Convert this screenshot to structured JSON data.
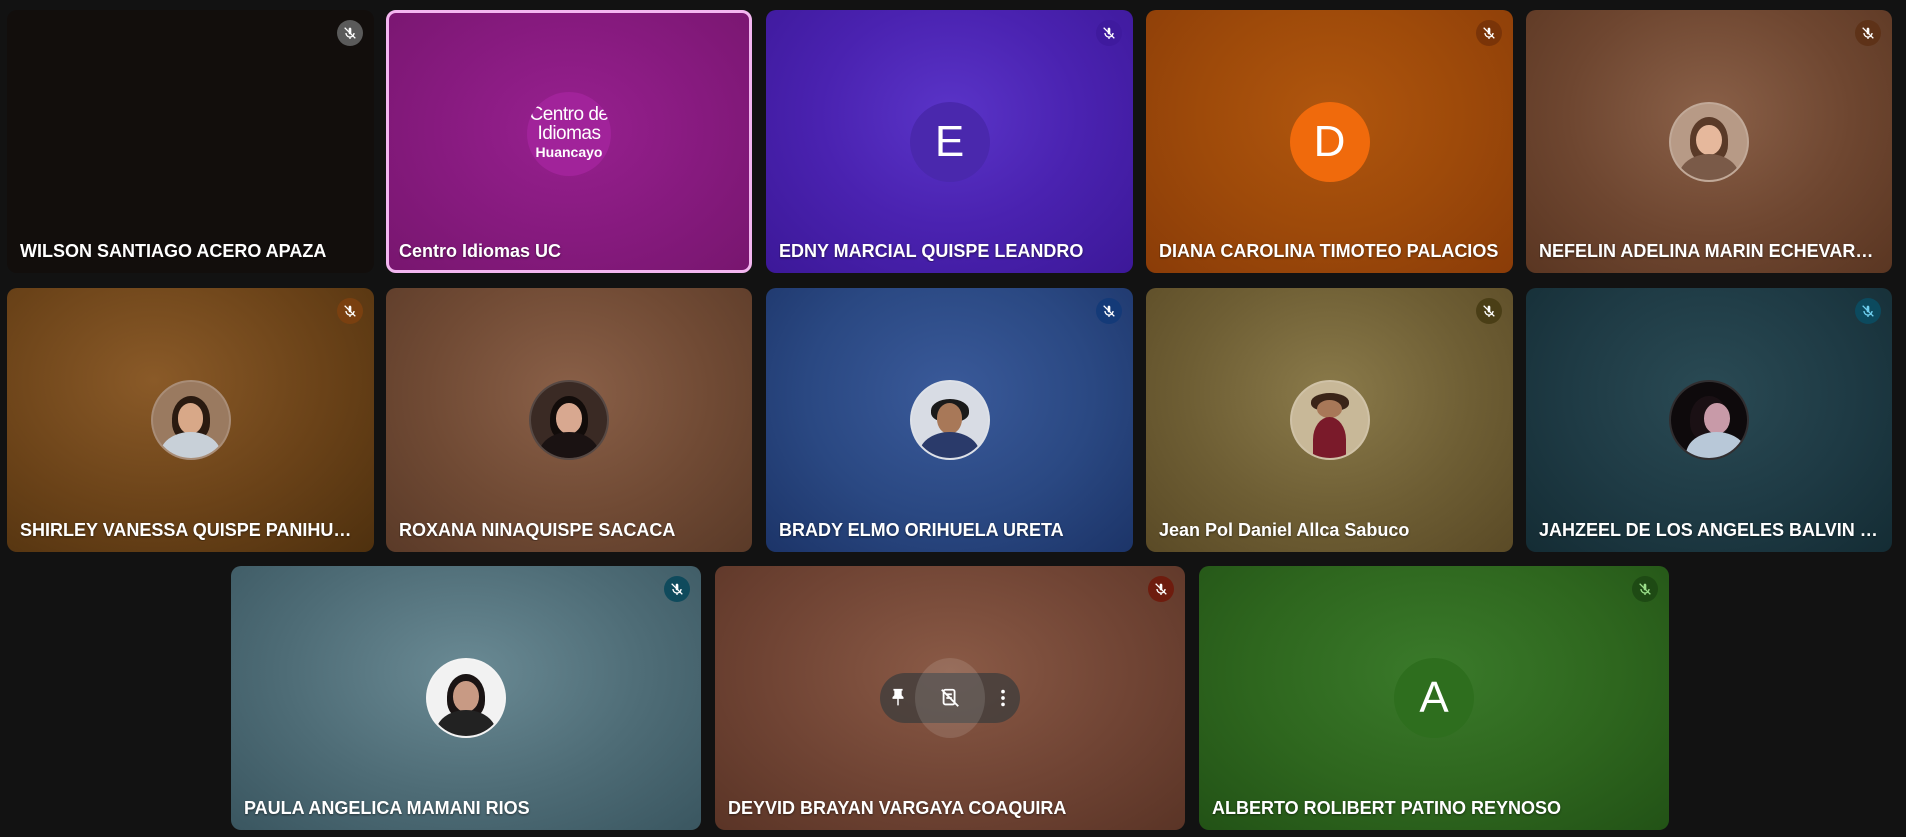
{
  "participants": [
    {
      "name": "WILSON SANTIAGO ACERO APAZA",
      "mic_color": "#5f6368"
    },
    {
      "name": "Centro Idiomas UC",
      "logo_line1": "Centro de",
      "logo_line2": "Idiomas",
      "logo_line3": "Huancayo",
      "mic_color": ""
    },
    {
      "name": "EDNY MARCIAL QUISPE LEANDRO",
      "initial": "E",
      "mic_color": "#4a1fb0",
      "avatar_color": "#4b29b3"
    },
    {
      "name": "DIANA CAROLINA TIMOTEO PALACIOS",
      "initial": "D",
      "mic_color": "#8a3f0c",
      "avatar_color": "#f06b0c"
    },
    {
      "name": "NEFELIN ADELINA MARIN ECHEVARRIA",
      "mic_color": "#6b3a1c"
    },
    {
      "name": "SHIRLEY VANESSA QUISPE PANIHUARA",
      "mic_color": "#8a4a12"
    },
    {
      "name": "ROXANA NINAQUISPE SACACA",
      "mic_color": ""
    },
    {
      "name": "BRADY ELMO ORIHUELA URETA",
      "mic_color": "#143a78"
    },
    {
      "name": "Jean Pol Daniel Allca Sabuco",
      "mic_color": "#4a3e16"
    },
    {
      "name": "JAHZEEL DE LOS ANGELES BALVIN H...",
      "mic_color": "#0c4a5e"
    },
    {
      "name": "PAULA ANGELICA MAMANI RIOS",
      "mic_color": "#0f4a5c"
    },
    {
      "name": "DEYVID BRAYAN VARGAYA COAQUIRA",
      "mic_color": "#6e1c0e"
    },
    {
      "name": "ALBERTO ROLIBERT PATINO REYNOSO",
      "initial": "A",
      "mic_color": "#1e4a14",
      "avatar_color": "#2e6e1e"
    }
  ],
  "icons": {
    "mic_off": "mic-off-icon",
    "pin": "pin-icon",
    "remove": "remove-from-call-icon",
    "more": "more-options-icon"
  }
}
